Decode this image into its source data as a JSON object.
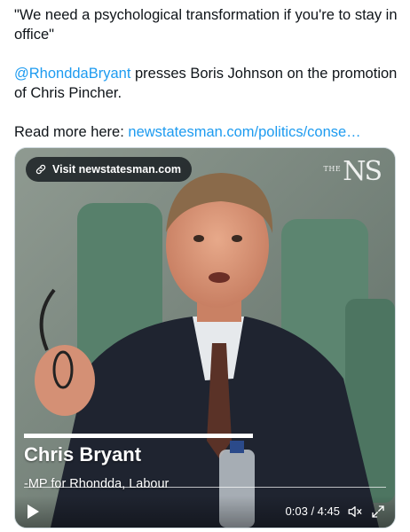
{
  "tweet": {
    "line1": "\"We need a psychological transformation if you're to stay in office\"",
    "mention": "@RhonddaBryant",
    "line2_rest": " presses Boris Johnson on the promotion of Chris Pincher.",
    "read_more_label": "Read more here: ",
    "read_more_link": "newstatesman.com/politics/conse…"
  },
  "media": {
    "visit_label": "Visit newstatesman.com",
    "logo_small": "THE",
    "logo_large": "NS",
    "lower_third_name": "Chris Bryant",
    "lower_third_role": "-MP for Rhondda, Labour",
    "timecode": "0:03 / 4:45"
  },
  "colors": {
    "link": "#1d9bf0",
    "text": "#0f1419"
  },
  "icons": [
    "link-icon",
    "play-icon",
    "mute-icon",
    "fullscreen-icon"
  ]
}
